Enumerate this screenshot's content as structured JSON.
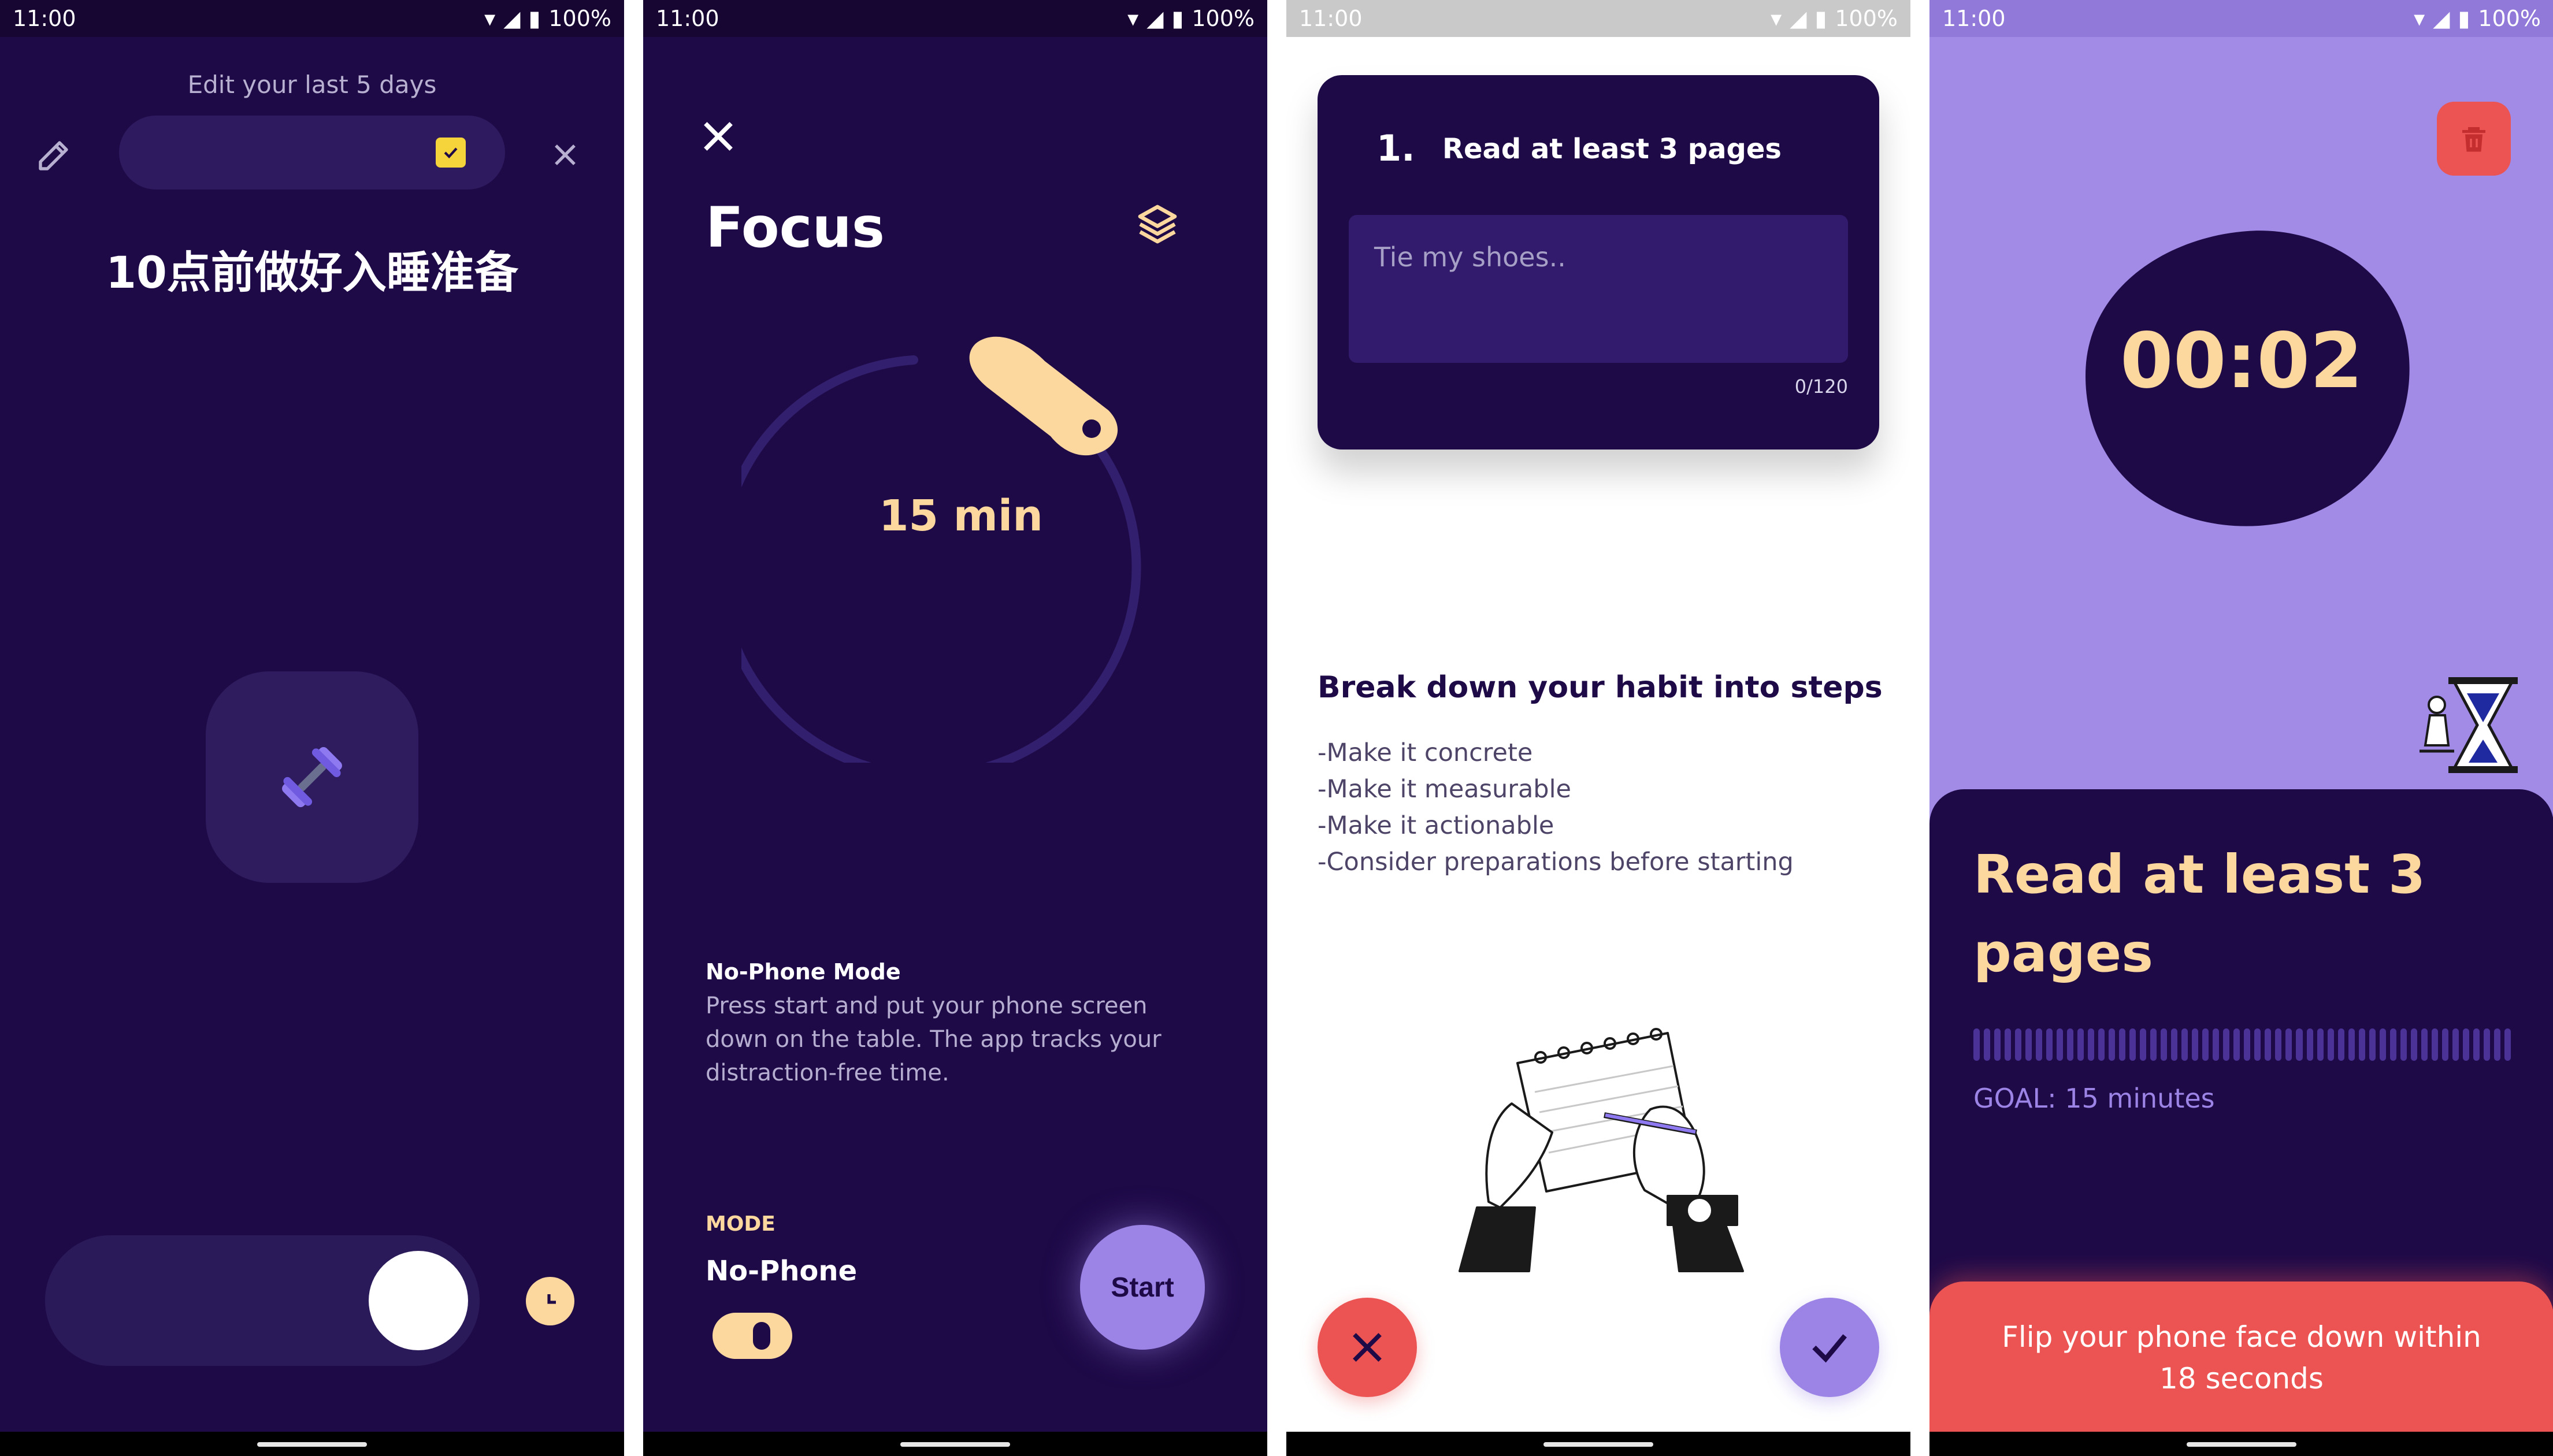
{
  "status": {
    "time": "11:00",
    "battery": "100%"
  },
  "screen1": {
    "title": "Edit your last 5 days",
    "habit_name": "10点前做好入睡准备",
    "icons": [
      "pencil-icon",
      "checkbox-icon",
      "close-icon",
      "dumbbell-icon",
      "clock-icon"
    ]
  },
  "screen2": {
    "title": "Focus",
    "dial_value": "15 min",
    "no_phone_title": "No-Phone Mode",
    "no_phone_desc": "Press start and put your phone screen down on the table. The app tracks your distraction-free time.",
    "mode_label": "MODE",
    "mode_value": "No-Phone",
    "start_label": "Start",
    "toggle_on": true
  },
  "screen3": {
    "step_number": "1.",
    "step_title": "Read at least 3 pages",
    "input_placeholder": "Tie my shoes..",
    "counter": "0/120",
    "heading": "Break down your habit into steps",
    "tips": [
      "-Make it concrete",
      "-Make it measurable",
      "-Make it actionable",
      "-Consider preparations before starting"
    ]
  },
  "screen4": {
    "timer": "00:02",
    "habit": "Read at least 3 pages",
    "goal": "GOAL: 15 minutes",
    "banner": "Flip your phone face down within 18 seconds",
    "progress_bars": 52
  },
  "colors": {
    "dark": "#1f0a48",
    "accent_peach": "#fdd89e",
    "accent_purple": "#9b84e6",
    "danger": "#ec5353",
    "yellow": "#f5d33a"
  }
}
